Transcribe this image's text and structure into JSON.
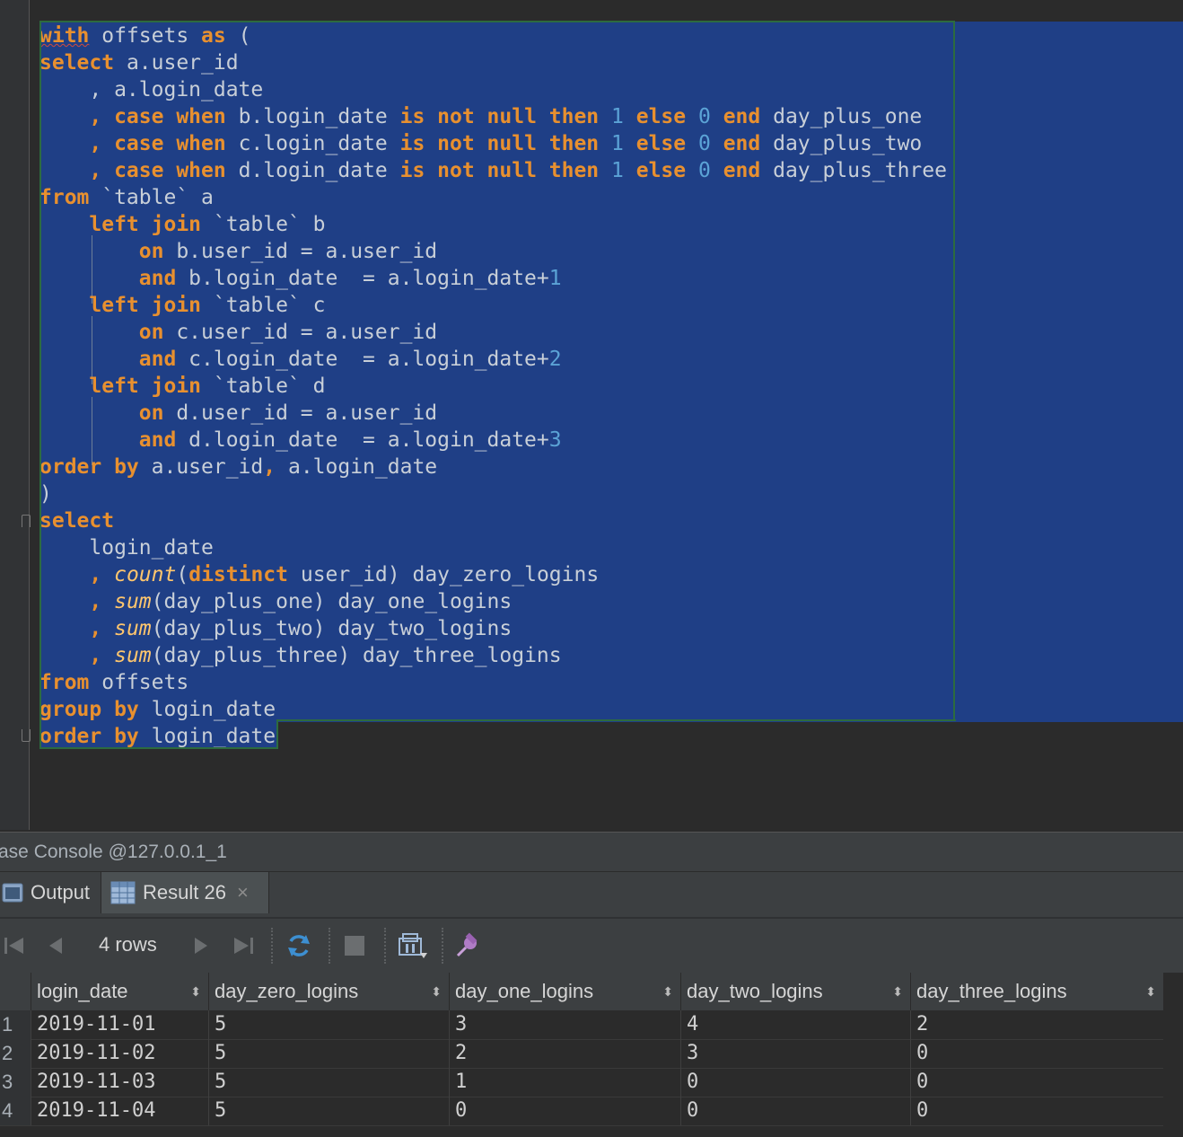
{
  "editor": {
    "lines": [
      [
        [
          "kw",
          "with"
        ],
        [
          "t",
          " offsets "
        ],
        [
          "kw",
          "as"
        ],
        [
          "t",
          " ("
        ]
      ],
      [
        [
          "kw",
          "select"
        ],
        [
          "t",
          " a.user_id"
        ]
      ],
      [
        [
          "t",
          "    , a.login_date"
        ]
      ],
      [
        [
          "t",
          "    "
        ],
        [
          "kw",
          ", case when"
        ],
        [
          "t",
          " b.login_date "
        ],
        [
          "kw",
          "is not null then"
        ],
        [
          "t",
          " "
        ],
        [
          "num",
          "1"
        ],
        [
          "t",
          " "
        ],
        [
          "kw",
          "else"
        ],
        [
          "t",
          " "
        ],
        [
          "num",
          "0"
        ],
        [
          "t",
          " "
        ],
        [
          "kw",
          "end"
        ],
        [
          "t",
          " day_plus_one"
        ]
      ],
      [
        [
          "t",
          "    "
        ],
        [
          "kw",
          ", case when"
        ],
        [
          "t",
          " c.login_date "
        ],
        [
          "kw",
          "is not null then"
        ],
        [
          "t",
          " "
        ],
        [
          "num",
          "1"
        ],
        [
          "t",
          " "
        ],
        [
          "kw",
          "else"
        ],
        [
          "t",
          " "
        ],
        [
          "num",
          "0"
        ],
        [
          "t",
          " "
        ],
        [
          "kw",
          "end"
        ],
        [
          "t",
          " day_plus_two"
        ]
      ],
      [
        [
          "t",
          "    "
        ],
        [
          "kw",
          ", case when"
        ],
        [
          "t",
          " d.login_date "
        ],
        [
          "kw",
          "is not null then"
        ],
        [
          "t",
          " "
        ],
        [
          "num",
          "1"
        ],
        [
          "t",
          " "
        ],
        [
          "kw",
          "else"
        ],
        [
          "t",
          " "
        ],
        [
          "num",
          "0"
        ],
        [
          "t",
          " "
        ],
        [
          "kw",
          "end"
        ],
        [
          "t",
          " day_plus_three"
        ]
      ],
      [
        [
          "kw",
          "from"
        ],
        [
          "t",
          " `table` a"
        ]
      ],
      [
        [
          "t",
          "    "
        ],
        [
          "kw",
          "left join"
        ],
        [
          "t",
          " `table` b"
        ]
      ],
      [
        [
          "t",
          "        "
        ],
        [
          "kw",
          "on"
        ],
        [
          "t",
          " b.user_id = a.user_id"
        ]
      ],
      [
        [
          "t",
          "        "
        ],
        [
          "kw",
          "and"
        ],
        [
          "t",
          " b.login_date  = a.login_date+"
        ],
        [
          "num",
          "1"
        ]
      ],
      [
        [
          "t",
          "    "
        ],
        [
          "kw",
          "left join"
        ],
        [
          "t",
          " `table` c"
        ]
      ],
      [
        [
          "t",
          "        "
        ],
        [
          "kw",
          "on"
        ],
        [
          "t",
          " c.user_id = a.user_id"
        ]
      ],
      [
        [
          "t",
          "        "
        ],
        [
          "kw",
          "and"
        ],
        [
          "t",
          " c.login_date  = a.login_date+"
        ],
        [
          "num",
          "2"
        ]
      ],
      [
        [
          "t",
          "    "
        ],
        [
          "kw",
          "left join"
        ],
        [
          "t",
          " `table` d"
        ]
      ],
      [
        [
          "t",
          "        "
        ],
        [
          "kw",
          "on"
        ],
        [
          "t",
          " d.user_id = a.user_id"
        ]
      ],
      [
        [
          "t",
          "        "
        ],
        [
          "kw",
          "and"
        ],
        [
          "t",
          " d.login_date  = a.login_date+"
        ],
        [
          "num",
          "3"
        ]
      ],
      [
        [
          "kw",
          "order by"
        ],
        [
          "t",
          " a.user_id"
        ],
        [
          "kw",
          ","
        ],
        [
          "t",
          " a.login_date"
        ]
      ],
      [
        [
          "t",
          ")"
        ]
      ],
      [
        [
          "kw",
          "select"
        ]
      ],
      [
        [
          "t",
          "    login_date"
        ]
      ],
      [
        [
          "t",
          "    "
        ],
        [
          "kw",
          ","
        ],
        [
          "t",
          " "
        ],
        [
          "fn",
          "count"
        ],
        [
          "t",
          "("
        ],
        [
          "kw",
          "distinct"
        ],
        [
          "t",
          " user_id) day_zero_logins"
        ]
      ],
      [
        [
          "t",
          "    "
        ],
        [
          "kw",
          ","
        ],
        [
          "t",
          " "
        ],
        [
          "fn",
          "sum"
        ],
        [
          "t",
          "(day_plus_one) day_one_logins"
        ]
      ],
      [
        [
          "t",
          "    "
        ],
        [
          "kw",
          ","
        ],
        [
          "t",
          " "
        ],
        [
          "fn",
          "sum"
        ],
        [
          "t",
          "(day_plus_two) day_two_logins"
        ]
      ],
      [
        [
          "t",
          "    "
        ],
        [
          "kw",
          ","
        ],
        [
          "t",
          " "
        ],
        [
          "fn",
          "sum"
        ],
        [
          "t",
          "(day_plus_three) day_three_logins"
        ]
      ],
      [
        [
          "kw",
          "from"
        ],
        [
          "t",
          " offsets"
        ]
      ],
      [
        [
          "kw",
          "group by"
        ],
        [
          "t",
          " login_date"
        ]
      ],
      [
        [
          "kw",
          "order by"
        ],
        [
          "t",
          " login_date"
        ]
      ]
    ]
  },
  "console": {
    "title": "ase Console @127.0.0.1_1"
  },
  "tabs": {
    "output_label": "Output",
    "result_label": "Result 26",
    "close_glyph": "×"
  },
  "toolbar": {
    "rows_label": "4 rows"
  },
  "table": {
    "columns": [
      "login_date",
      "day_zero_logins",
      "day_one_logins",
      "day_two_logins",
      "day_three_logins"
    ],
    "sort_glyph": "⬍",
    "rows": [
      {
        "num": "1",
        "cells": [
          "2019-11-01",
          "5",
          "3",
          "4",
          "2"
        ]
      },
      {
        "num": "2",
        "cells": [
          "2019-11-02",
          "5",
          "2",
          "3",
          "0"
        ]
      },
      {
        "num": "3",
        "cells": [
          "2019-11-03",
          "5",
          "1",
          "0",
          "0"
        ]
      },
      {
        "num": "4",
        "cells": [
          "2019-11-04",
          "5",
          "0",
          "0",
          "0"
        ]
      }
    ]
  },
  "colors": {
    "keyword": "#e8902f",
    "number": "#5ba3d6",
    "function": "#ffc66d",
    "selection": "#1f3f86"
  }
}
